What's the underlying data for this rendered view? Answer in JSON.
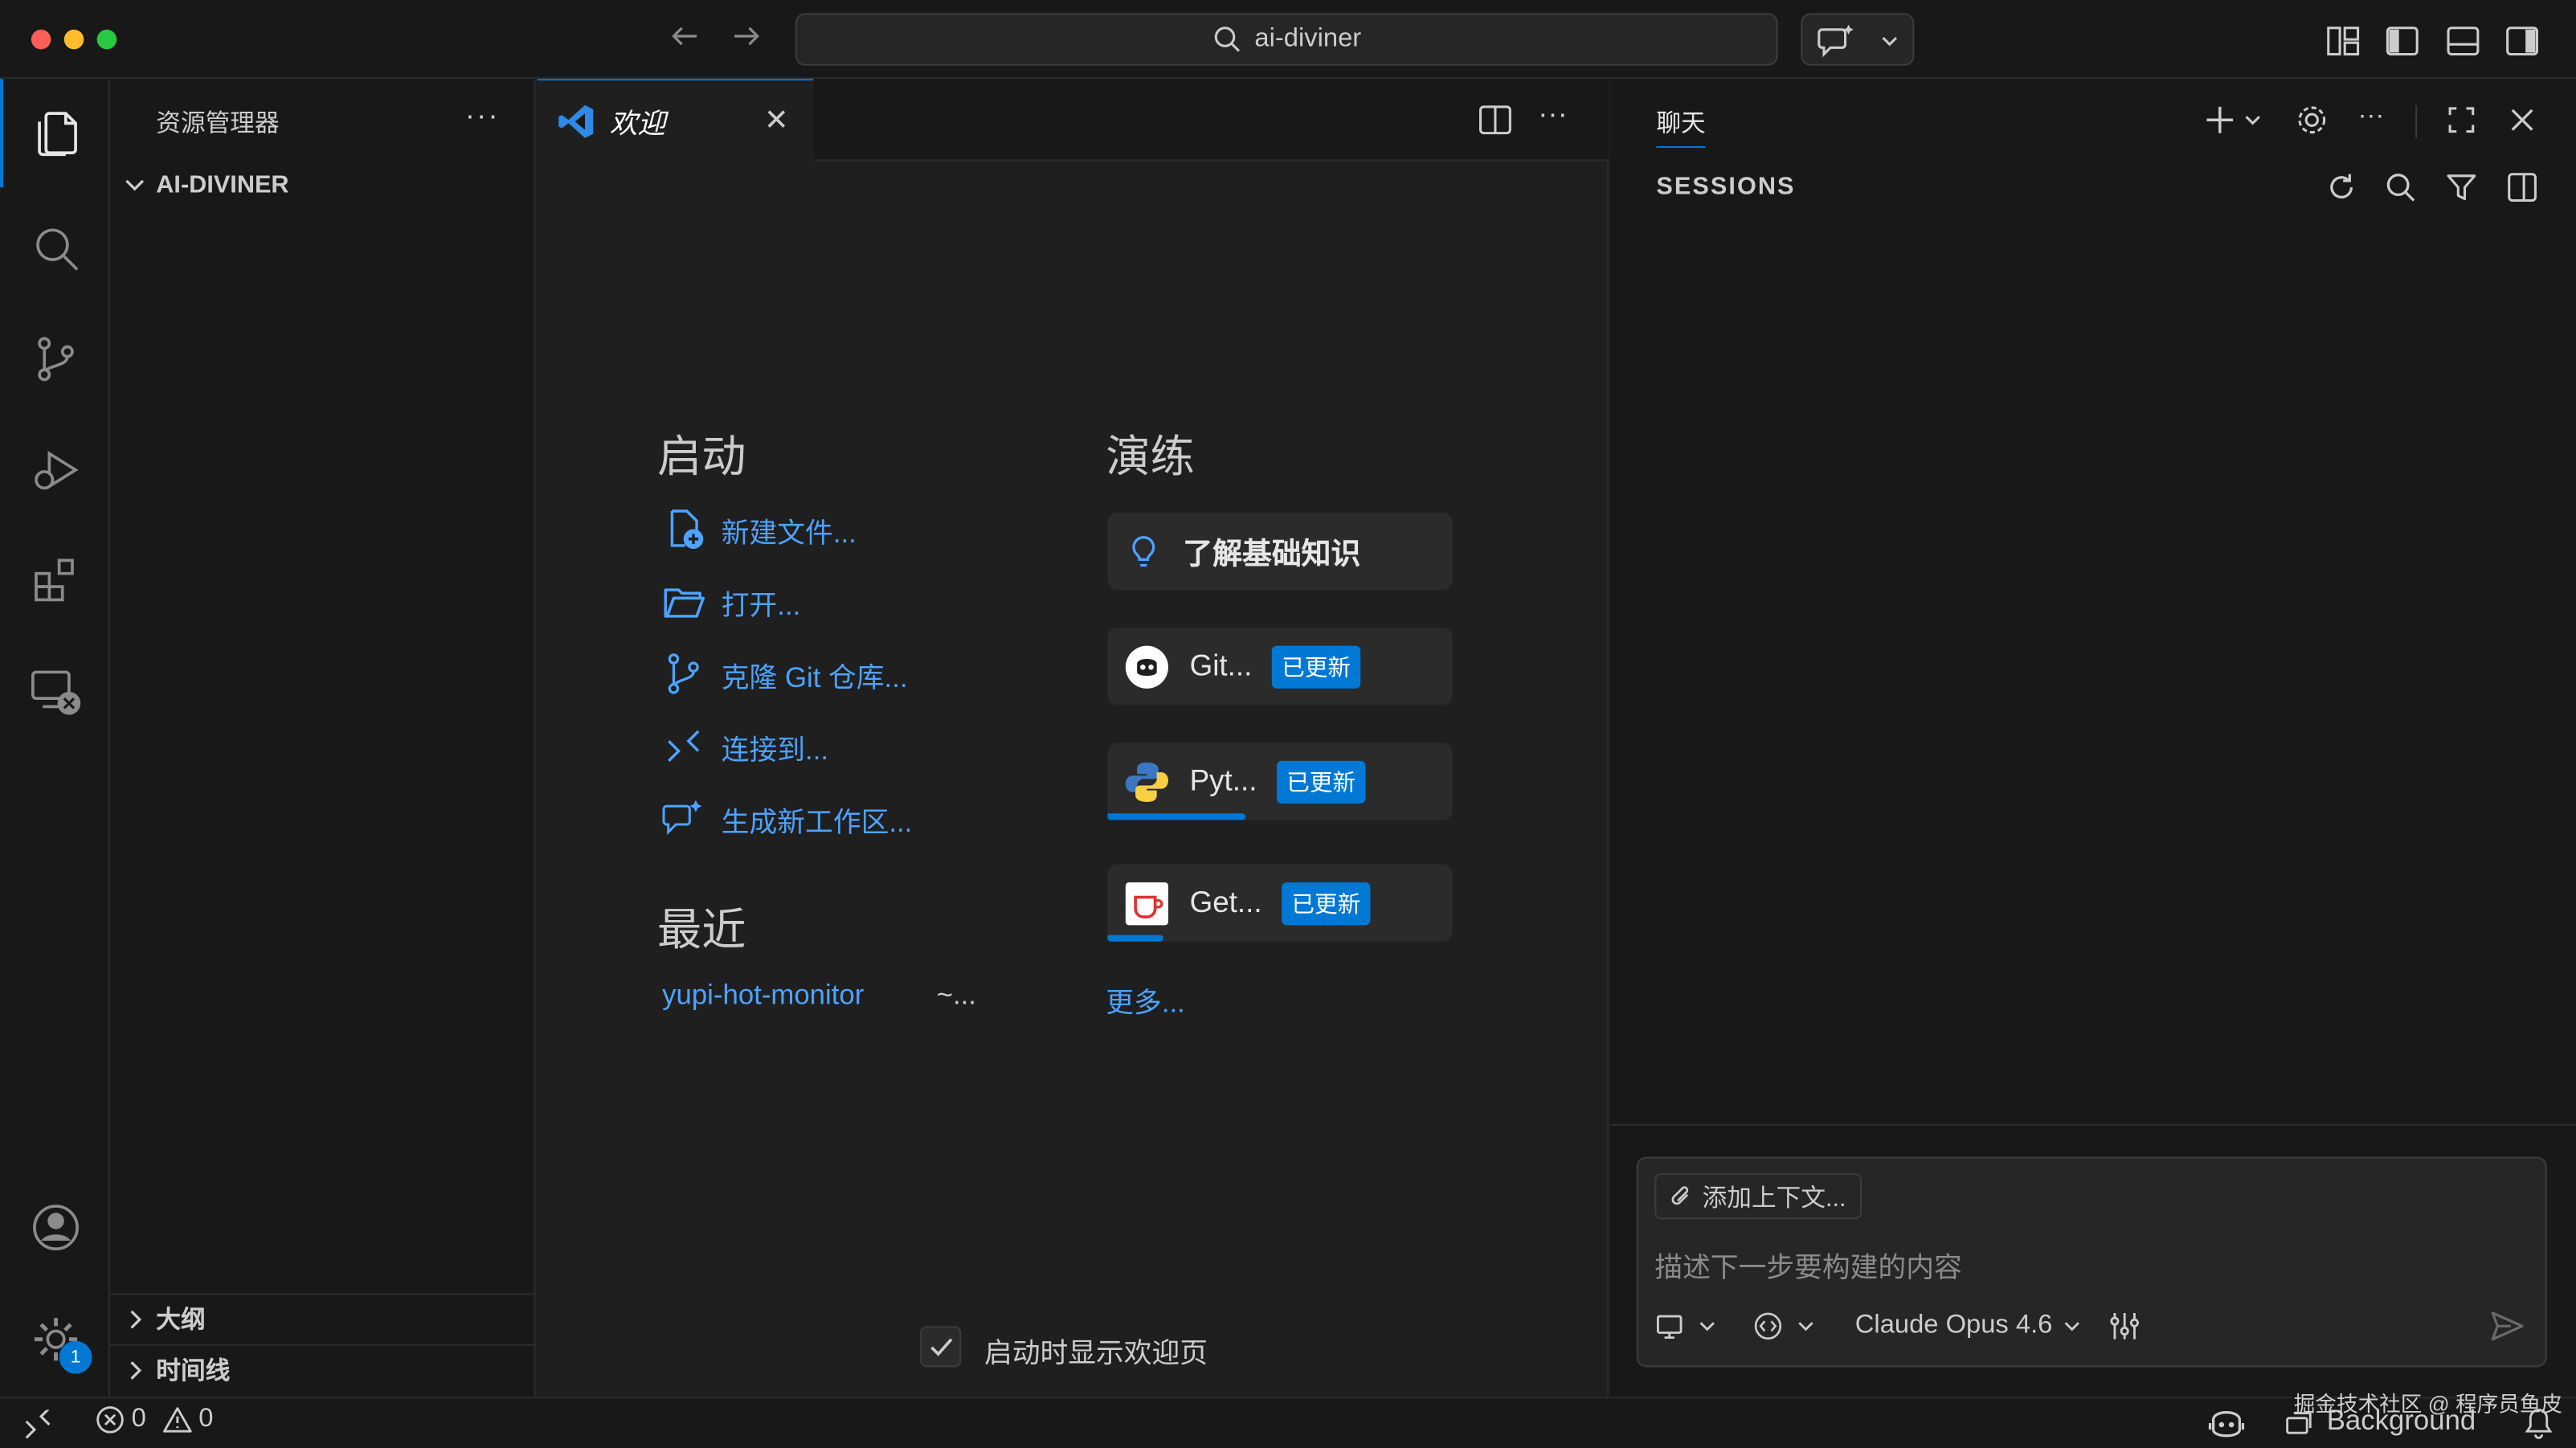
{
  "window": {
    "search_text": "ai-diviner",
    "traffic_colors": [
      "#ff5f57",
      "#febc2e",
      "#28c840"
    ]
  },
  "activity": {
    "settings_badge": "1"
  },
  "sidebar": {
    "title": "资源管理器",
    "more": "···",
    "folder": "AI-DIVINER",
    "outline": "大纲",
    "timeline": "时间线"
  },
  "editor": {
    "tab_label": "欢迎",
    "tab_close": "✕",
    "more": "···"
  },
  "welcome": {
    "start_heading": "启动",
    "start_links": [
      "新建文件...",
      "打开...",
      "克隆 Git 仓库...",
      "连接到...",
      "生成新工作区..."
    ],
    "recent_heading": "最近",
    "recent_name": "yupi-hot-monitor",
    "recent_path": "~...",
    "walkthrough_heading": "演练",
    "walkthroughs": [
      {
        "label": "了解基础知识"
      },
      {
        "label": "Git...",
        "badge": "已更新"
      },
      {
        "label": "Pyt...",
        "badge": "已更新",
        "progress": 0.4
      },
      {
        "label": "Get...",
        "badge": "已更新",
        "progress": 0.16
      }
    ],
    "more": "更多...",
    "show_on_startup": "启动时显示欢迎页"
  },
  "chat": {
    "tab": "聊天",
    "sessions": "SESSIONS",
    "add_context": "添加上下文...",
    "placeholder": "描述下一步要构建的内容",
    "model": "Claude Opus 4.6",
    "more": "···"
  },
  "status": {
    "errors": "0",
    "warnings": "0",
    "background": "Background",
    "watermark": "掘金技术社区 @ 程序员鱼皮"
  },
  "colors": {
    "accent": "#0078d4",
    "link": "#4da3ff"
  }
}
